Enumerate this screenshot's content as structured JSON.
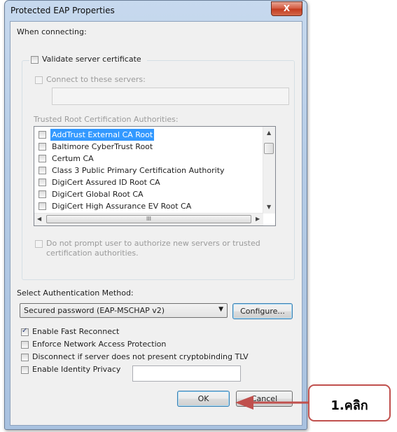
{
  "window": {
    "title": "Protected EAP Properties",
    "close_label": "X"
  },
  "connecting": {
    "heading": "When connecting:",
    "validate_label": "Validate server certificate",
    "connect_servers_label": "Connect to these servers:",
    "trusted_heading": "Trusted Root Certification Authorities:",
    "cas": [
      "AddTrust External CA Root",
      "Baltimore CyberTrust Root",
      "Certum CA",
      "Class 3 Public Primary Certification Authority",
      "DigiCert Assured ID Root CA",
      "DigiCert Global Root CA",
      "DigiCert High Assurance EV Root CA"
    ],
    "hscroll_grip": "III",
    "no_prompt_line1": "Do not prompt user to authorize new servers or trusted",
    "no_prompt_line2": "certification authorities."
  },
  "auth": {
    "heading": "Select Authentication Method:",
    "method": "Secured password (EAP-MSCHAP v2)",
    "configure_label": "Configure..."
  },
  "options": {
    "fast_reconnect": "Enable Fast Reconnect",
    "nap": "Enforce Network Access Protection",
    "cryptobinding": "Disconnect if server does not present cryptobinding TLV",
    "identity_privacy": "Enable Identity Privacy"
  },
  "buttons": {
    "ok": "OK",
    "cancel": "Cancel"
  },
  "annotation": {
    "text": "1.คลิก",
    "color": "#c0504d"
  }
}
